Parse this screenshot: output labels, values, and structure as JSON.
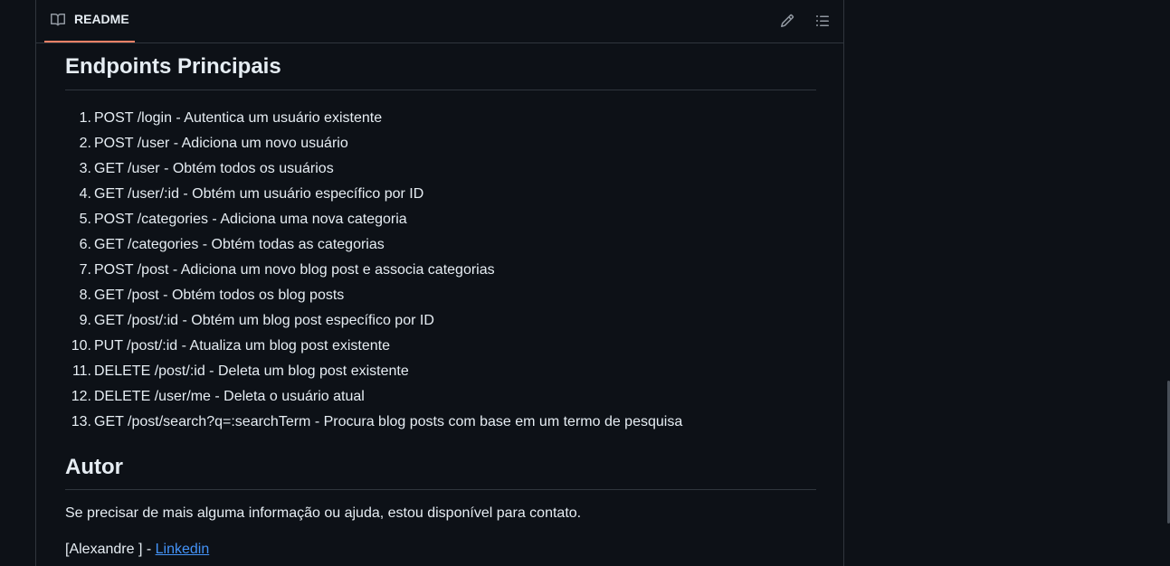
{
  "readme": {
    "tab_label": "README",
    "icons": {
      "tab": "book-icon",
      "edit": "pencil-icon",
      "outline": "list-unordered-icon"
    }
  },
  "endpoints_section": {
    "heading": "Endpoints Principais",
    "items": [
      "POST /login - Autentica um usuário existente",
      "POST /user - Adiciona um novo usuário",
      "GET /user - Obtém todos os usuários",
      "GET /user/:id - Obtém um usuário específico por ID",
      "POST /categories - Adiciona uma nova categoria",
      "GET /categories - Obtém todas as categorias",
      "POST /post - Adiciona um novo blog post e associa categorias",
      "GET /post - Obtém todos os blog posts",
      "GET /post/:id - Obtém um blog post específico por ID",
      "PUT /post/:id - Atualiza um blog post existente",
      "DELETE /post/:id - Deleta um blog post existente",
      "DELETE /user/me - Deleta o usuário atual",
      "GET /post/search?q=:searchTerm - Procura blog posts com base em um termo de pesquisa"
    ]
  },
  "author_section": {
    "heading": "Autor",
    "text": "Se precisar de mais alguma informação ou ajuda, estou disponível para contato.",
    "author_name": "[Alexandre ] - ",
    "link_label": "Linkedin"
  },
  "colors": {
    "background": "#0d1117",
    "border": "#30363d",
    "text": "#e6edf3",
    "tab_underline": "#f78166",
    "link": "#4493f8"
  }
}
